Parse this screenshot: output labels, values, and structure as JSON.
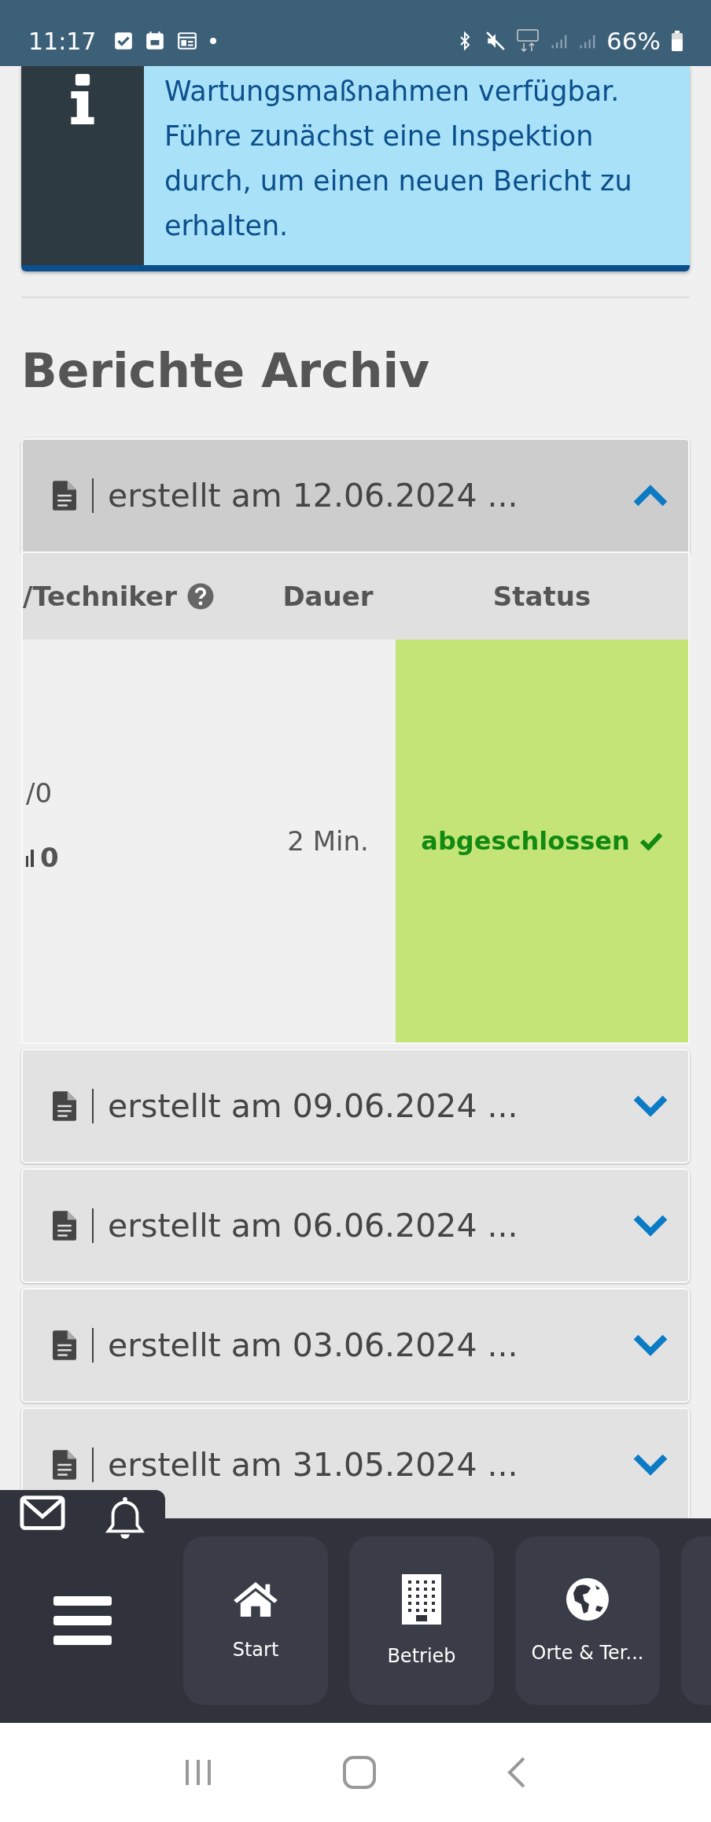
{
  "status_bar": {
    "time": "11:17",
    "battery": "66%"
  },
  "info": {
    "text": "Wartungsmaßnahmen verfügbar. Führe zunächst eine Inspektion durch, um einen neuen Bericht zu erhalten."
  },
  "archive": {
    "title": "Berichte Archiv",
    "reports": [
      {
        "label": "erstellt am 12.06.2024 ...",
        "expanded": true,
        "table": {
          "columns": [
            "/Techniker",
            "Dauer",
            "Status"
          ],
          "rows": [
            {
              "technician": [
                "/0",
                "0"
              ],
              "duration": "2 Min.",
              "status": "abgeschlossen",
              "kind": "completed"
            }
          ]
        }
      },
      {
        "label": "erstellt am 09.06.2024 ...",
        "expanded": false
      },
      {
        "label": "erstellt am 06.06.2024 ...",
        "expanded": false
      },
      {
        "label": "erstellt am 03.06.2024 ...",
        "expanded": false
      },
      {
        "label": "erstellt am 31.05.2024 ...",
        "expanded": false
      }
    ]
  },
  "bottom_nav": {
    "items": [
      {
        "label": "Start",
        "kind": "home"
      },
      {
        "label": "Betrieb",
        "kind": "building"
      },
      {
        "label": "Orte & Ter...",
        "kind": "globe"
      }
    ]
  }
}
